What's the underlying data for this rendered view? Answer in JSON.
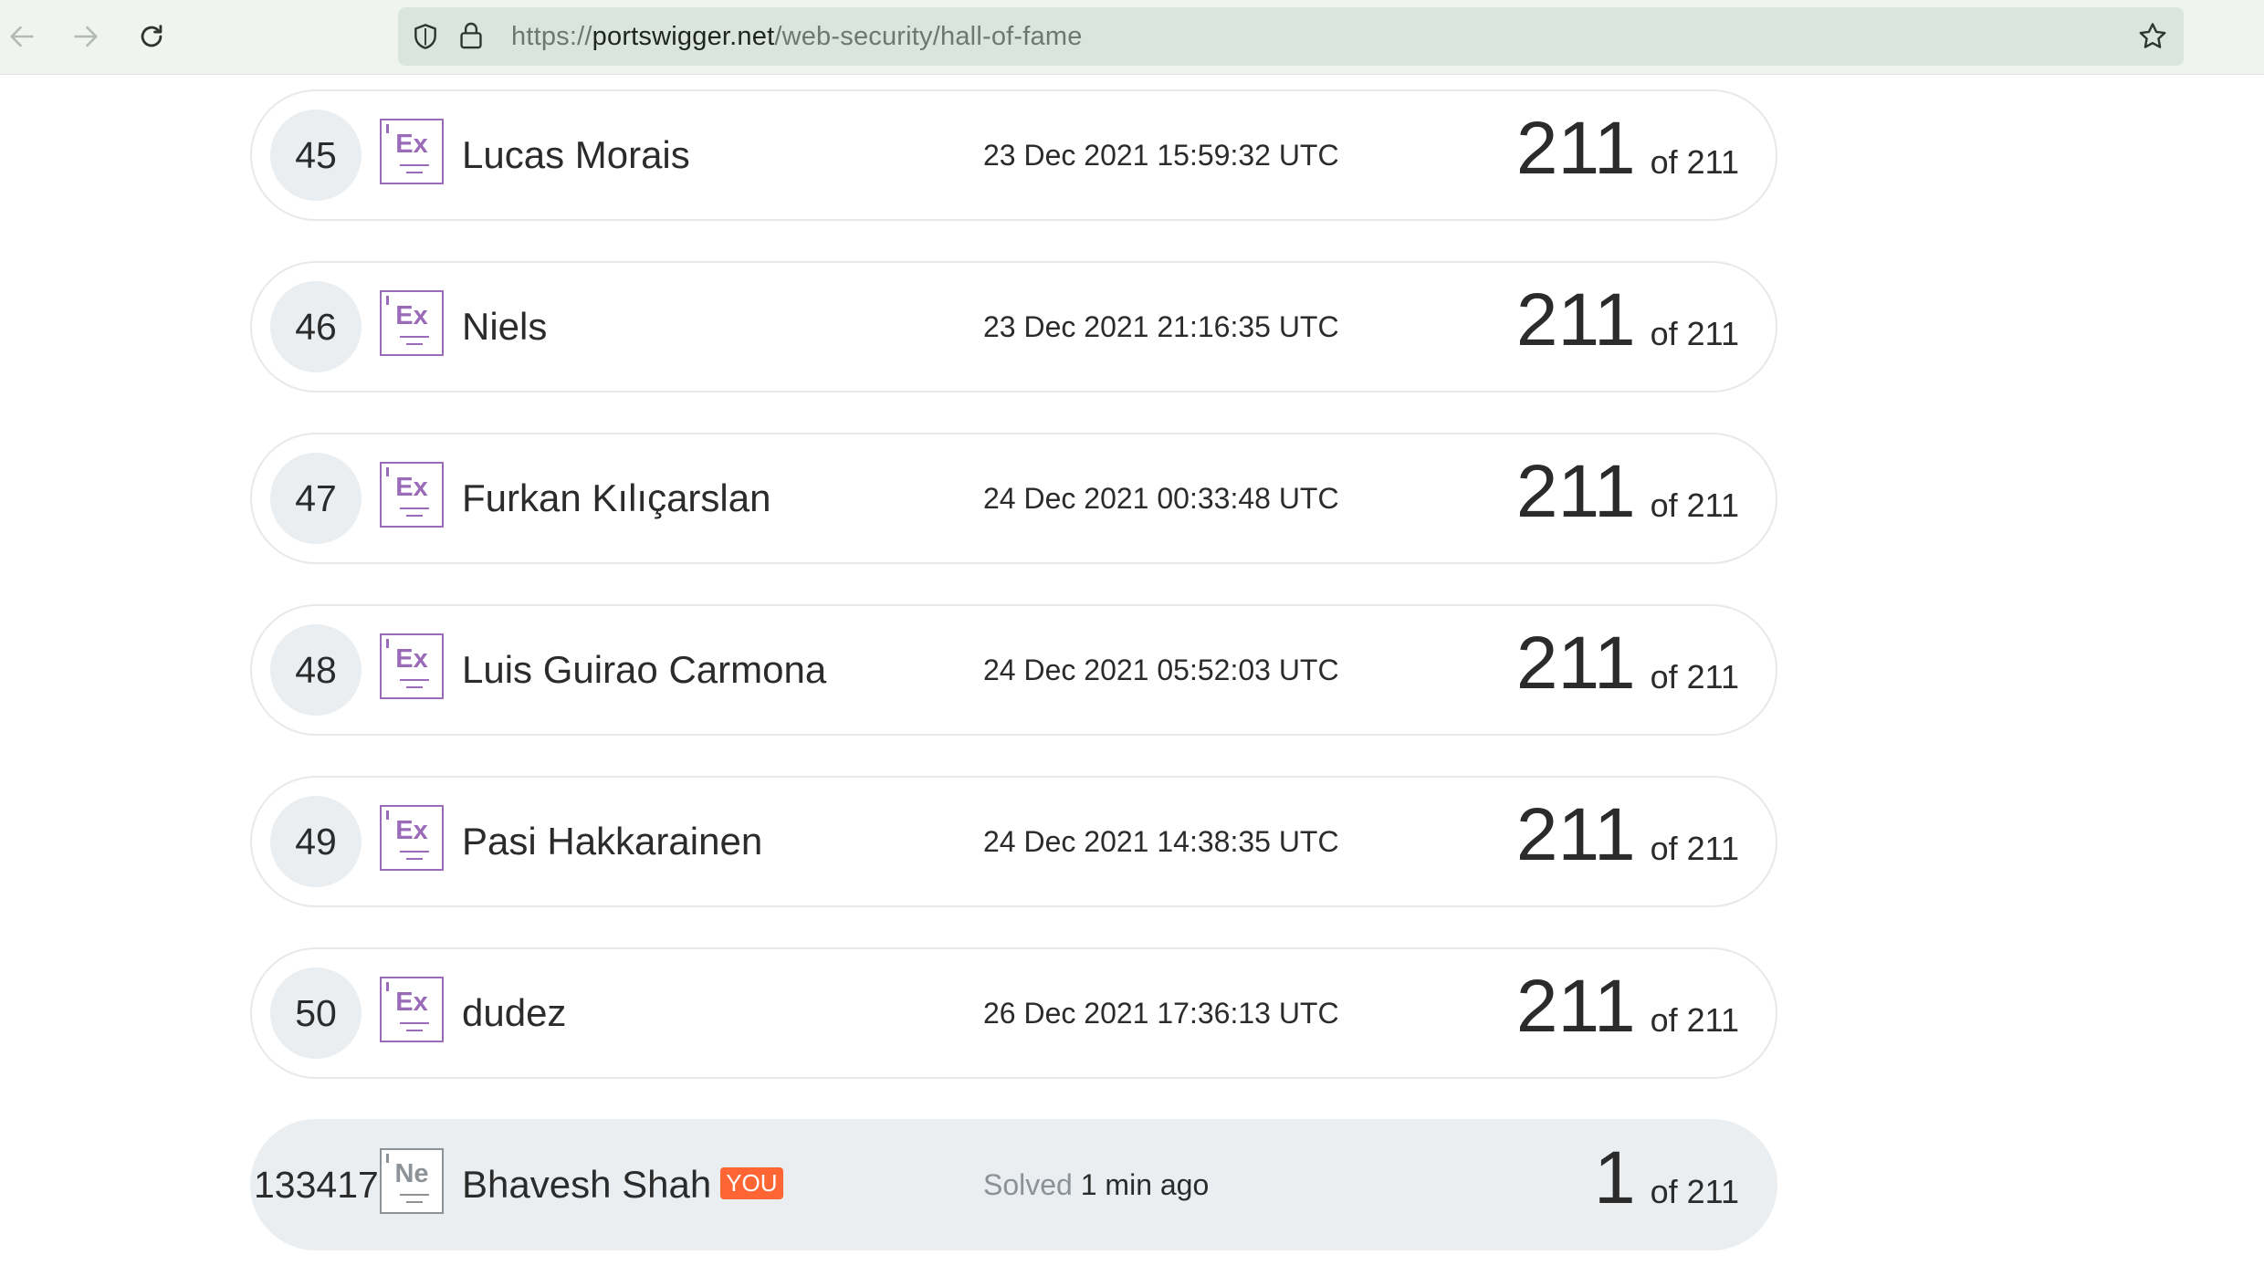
{
  "browser": {
    "url_scheme": "https://",
    "url_host": "portswigger.net",
    "url_path": "/web-security/hall-of-fame"
  },
  "leaderboard": [
    {
      "rank": "45",
      "badge": "Ex",
      "name": "Lucas Morais",
      "date": "23 Dec 2021 15:59:32 UTC",
      "score": "211",
      "total": "of 211"
    },
    {
      "rank": "46",
      "badge": "Ex",
      "name": "Niels",
      "date": "23 Dec 2021 21:16:35 UTC",
      "score": "211",
      "total": "of 211"
    },
    {
      "rank": "47",
      "badge": "Ex",
      "name": "Furkan Kılıçarslan",
      "date": "24 Dec 2021 00:33:48 UTC",
      "score": "211",
      "total": "of 211"
    },
    {
      "rank": "48",
      "badge": "Ex",
      "name": "Luis Guirao Carmona",
      "date": "24 Dec 2021 05:52:03 UTC",
      "score": "211",
      "total": "of 211"
    },
    {
      "rank": "49",
      "badge": "Ex",
      "name": "Pasi Hakkarainen",
      "date": "24 Dec 2021 14:38:35 UTC",
      "score": "211",
      "total": "of 211"
    },
    {
      "rank": "50",
      "badge": "Ex",
      "name": "dudez",
      "date": "26 Dec 2021 17:36:13 UTC",
      "score": "211",
      "total": "of 211"
    }
  ],
  "current_user": {
    "rank": "133417",
    "badge": "Ne",
    "name": "Bhavesh Shah",
    "you_label": "YOU",
    "solved_label": "Solved",
    "solved_time": "1 min ago",
    "score": "1",
    "total": "of 211"
  },
  "colors": {
    "expert_badge": "#9a6bb8",
    "novice_badge": "#8d9297",
    "you_tag": "#ff6633"
  }
}
